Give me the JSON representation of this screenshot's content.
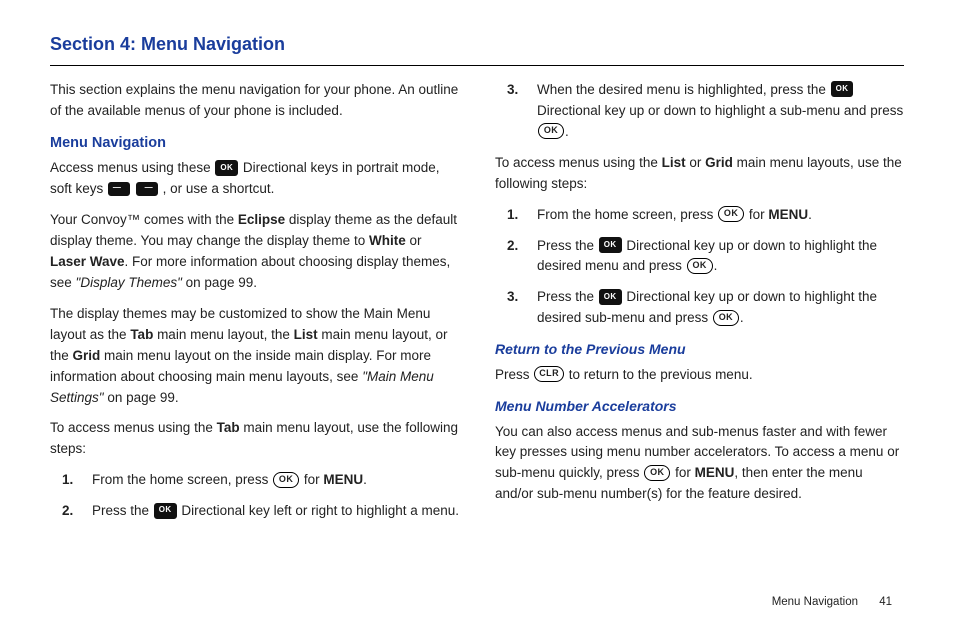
{
  "heading": "Section 4:  Menu Navigation",
  "left": {
    "intro": "This section explains the menu navigation for your phone. An outline of the available menus of your phone is included.",
    "h1": "Menu Navigation",
    "p1a": "Access menus using these ",
    "p1b": " Directional keys in portrait mode, soft keys ",
    "p1c": ", or use a shortcut.",
    "p2a": "Your Convoy™ comes with the ",
    "p2b": " display theme as the default display theme. You may change the display theme to ",
    "p2c": " or ",
    "p2d": ". For more information about choosing display themes, see ",
    "p2e": " on page 99.",
    "eclipse": "Eclipse",
    "white": "White",
    "laserwave": "Laser Wave",
    "ref1": "\"Display Themes\"",
    "p3a": "The display themes may be customized to show the Main Menu layout as the ",
    "tab": "Tab",
    "p3b": " main menu layout, the ",
    "list": "List",
    "p3c": " main menu layout, or the ",
    "grid": "Grid",
    "p3d": " main menu layout on the inside main display. For more information about choosing main menu layouts, see ",
    "ref2": "\"Main Menu Settings\"",
    "p3e": " on page 99.",
    "p4a": "To access menus using the ",
    "p4b": " main menu layout, use the following steps:",
    "steps": [
      {
        "n": "1.",
        "a": "From the home screen, press ",
        "b": " for ",
        "menu": "MENU",
        "c": "."
      },
      {
        "n": "2.",
        "a": "Press the ",
        "b": " Directional key left or right to highlight a menu."
      }
    ]
  },
  "right": {
    "step3": {
      "n": "3.",
      "a": "When the desired menu is highlighted, press the ",
      "b": " Directional key up or down to highlight a sub-menu and press ",
      "c": "."
    },
    "p1a": "To access menus using the ",
    "list": "List",
    "or": " or ",
    "grid": "Grid",
    "p1b": " main menu layouts, use the following steps:",
    "steps2": [
      {
        "n": "1.",
        "a": "From the home screen, press ",
        "b": " for ",
        "menu": "MENU",
        "c": "."
      },
      {
        "n": "2.",
        "a": "Press the ",
        "b": " Directional key up or down to highlight the desired menu and press ",
        "c": "."
      },
      {
        "n": "3.",
        "a": "Press the ",
        "b": " Directional key up or down to highlight the desired sub-menu and press ",
        "c": "."
      }
    ],
    "h2a": "Return to the Previous Menu",
    "ret_a": "Press ",
    "ret_b": " to return to the previous menu.",
    "h2b": "Menu Number Accelerators",
    "acc_a": "You can also access menus and sub-menus faster and with fewer key presses using menu number accelerators. To access a menu or sub-menu quickly, press ",
    "acc_b": " for ",
    "acc_menu": "MENU",
    "acc_c": ", then enter the menu and/or sub-menu number(s) for the feature desired."
  },
  "keys": {
    "ok": "OK",
    "dir": "OK",
    "clr": "CLR",
    "softL": "—",
    "softR": "—"
  },
  "footer": {
    "label": "Menu Navigation",
    "page": "41"
  }
}
